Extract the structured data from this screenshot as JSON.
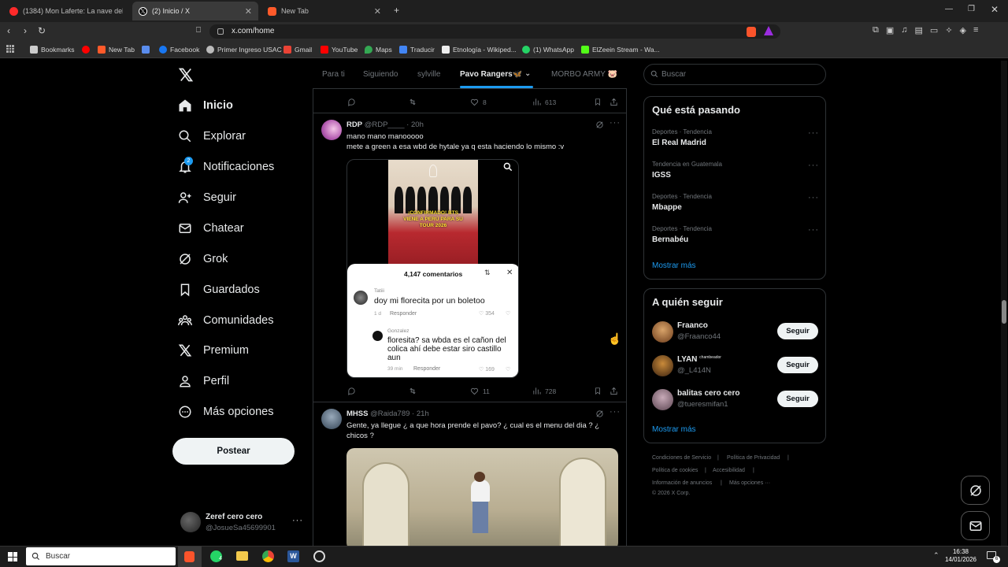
{
  "browser": {
    "tabs": [
      {
        "title": "(1384) Mon Laferte: La nave del olvid",
        "color": "#ff2a2a"
      },
      {
        "title": "(2) Inicio / X",
        "color": "#ffffff"
      },
      {
        "title": "New Tab",
        "color": "#ff5a2a"
      }
    ],
    "url": "x.com/home",
    "bookmarks": [
      {
        "label": "Bookmarks",
        "color": "#cccccc"
      },
      {
        "label": "",
        "color": "#ff0000"
      },
      {
        "label": "New Tab",
        "color": "#ff5a2a"
      },
      {
        "label": "",
        "color": "#5a8dee"
      },
      {
        "label": "Facebook",
        "color": "#1877f2"
      },
      {
        "label": "Primer Ingreso USAC",
        "color": "#bbbbbb"
      },
      {
        "label": "Gmail",
        "color": "#ea4335"
      },
      {
        "label": "YouTube",
        "color": "#ff0000"
      },
      {
        "label": "Maps",
        "color": "#34a853"
      },
      {
        "label": "Traducir",
        "color": "#4285f4"
      },
      {
        "label": "Etnología - Wikiped...",
        "color": "#eeeeee"
      },
      {
        "label": "(1) WhatsApp",
        "color": "#25d366"
      },
      {
        "label": "ElZeein Stream - Wa...",
        "color": "#53fc18"
      }
    ]
  },
  "sidebar": {
    "items": [
      {
        "label": "Inicio",
        "icon": "home-icon"
      },
      {
        "label": "Explorar",
        "icon": "search-icon"
      },
      {
        "label": "Notificaciones",
        "icon": "bell-icon",
        "badge": "2"
      },
      {
        "label": "Seguir",
        "icon": "person-add-icon"
      },
      {
        "label": "Chatear",
        "icon": "mail-icon"
      },
      {
        "label": "Grok",
        "icon": "grok-icon"
      },
      {
        "label": "Guardados",
        "icon": "bookmark-icon"
      },
      {
        "label": "Comunidades",
        "icon": "communities-icon"
      },
      {
        "label": "Premium",
        "icon": "x-logo-icon"
      },
      {
        "label": "Perfil",
        "icon": "person-icon"
      },
      {
        "label": "Más opciones",
        "icon": "more-circle-icon"
      }
    ],
    "post_label": "Postear",
    "account": {
      "name": "Zeref cero cero",
      "handle": "@JosueSa45699901"
    }
  },
  "feed": {
    "tabs": [
      "Para ti",
      "Siguiendo",
      "sylville",
      "Pavo Rangers🦋",
      "MORBO ARMY 🐷"
    ],
    "top_stats": {
      "replies": "",
      "reposts": "",
      "likes": "8",
      "views": "613"
    },
    "posts": [
      {
        "name": "RDP",
        "handle": "@RDP____",
        "time": "20h",
        "text1": "mano mano manooooo",
        "text2": "mete a green a esa wbd de hytale ya q esta haciendo lo mismo :v",
        "video_caption": "¡CONFIRMADO! BTS VIENE A PERÚ PARA SU TOUR 2026",
        "comments_header": "4,147 comentarios",
        "comment1": {
          "user": "Tatiii",
          "text": "doy mi florecita por un boletoo",
          "meta": "1 d",
          "reply": "Responder",
          "likes": "354"
        },
        "comment2": {
          "user": "Gonzalez",
          "text": "floresita? sa wbda es el cañon del colica ahí debe estar siro castillo aun",
          "meta": "39 min",
          "reply": "Responder",
          "likes": "169"
        },
        "stats": {
          "replies": "",
          "reposts": "",
          "likes": "11",
          "views": "728"
        }
      },
      {
        "name": "MHSS",
        "handle": "@Raida789",
        "time": "21h",
        "text1": "Gente, ya llegue ¿ a que hora prende el pavo? ¿ cual es el menu del dia ? ¿",
        "text2": "chicos ?"
      }
    ]
  },
  "right": {
    "search_placeholder": "Buscar",
    "trends_title": "Qué está pasando",
    "trends": [
      {
        "meta": "Deportes · Tendencia",
        "name": "El Real Madrid"
      },
      {
        "meta": "Tendencia en Guatemala",
        "name": "IGSS"
      },
      {
        "meta": "Deportes · Tendencia",
        "name": "Mbappe"
      },
      {
        "meta": "Deportes · Tendencia",
        "name": "Bernabéu"
      }
    ],
    "show_more": "Mostrar más",
    "follow_title": "A quién seguir",
    "follow": [
      {
        "name": "Fraanco",
        "handle": "@Fraanco44",
        "avatar": "#b07a3a"
      },
      {
        "name": "LYAN",
        "tag": "chambeador",
        "handle": "@_L414N",
        "avatar": "#8a5a2a"
      },
      {
        "name": "balitas cero cero",
        "handle": "@tueresmifan1",
        "avatar": "#9a7a8a"
      }
    ],
    "follow_label": "Seguir",
    "footer": [
      "Condiciones de Servicio",
      "Política de Privacidad",
      "Política de cookies",
      "Accesibilidad",
      "Información de anuncios",
      "Más opciones ···",
      "© 2026 X Corp."
    ]
  },
  "taskbar": {
    "search": "Buscar",
    "time": "16:38",
    "date": "14/01/2026",
    "whatsapp_badge": "4",
    "notif_badge": "6"
  }
}
